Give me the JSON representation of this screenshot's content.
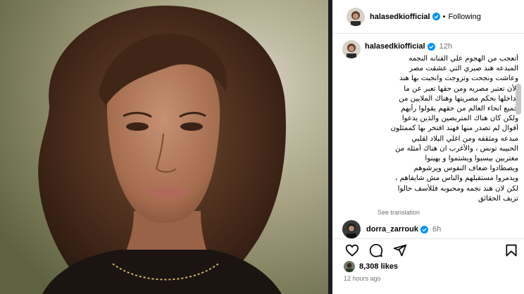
{
  "post": {
    "username": "halasedkiofficial",
    "follow_status": "Following",
    "separator": "•",
    "time": "12h",
    "caption_lines": [
      "أتعجب من الهجوم علي الفنانه النجمه",
      "المبدعه هند صبري التي عشقت مصر",
      "وعاشت ونجحت وتزوجت وانجبت بها هند",
      "الأن تعتبر مصريه ومن حقها تعبر عن ما",
      "بداخلها بحكم مصريتها وهناك الملايين من",
      "جميع انحاء العالم من حقهم يقولوا رأيهم",
      "ولكن كان هناك المتربصين والذين يدعوا",
      "أقوال لم تصدر منها فهند افتخر بها كممثلون",
      "مبدعه ومثقفه ومن اغلي البلاد لقلبي",
      "الحبيبه تونس ، والأغرب ان هناك أمثله من",
      "مغتربين بيسبوا ويشتموا و يهينوا",
      "ويصطادوا ضعاف النفوس ويرشوهم",
      "ويدمروا مستقبلهم والناس مش شايفاهم ،",
      "لكن لان هند نجمه ومحبوبه فللأسف حالوا",
      "تزيف الحقائق"
    ],
    "see_translation": "See translation",
    "likes": "8,308 likes",
    "time_ago": "12 hours ago"
  },
  "comments": [
    {
      "username": "dorra_zarrouk",
      "time": "6h",
      "verified": true
    }
  ],
  "icons": {
    "verified": "verified-badge-icon",
    "like": "heart-icon",
    "comment": "comment-icon",
    "share": "share-icon",
    "save": "bookmark-icon"
  },
  "colors": {
    "verified": "#0095f6",
    "meta_text": "#737373",
    "divider": "#e6e6e6"
  }
}
